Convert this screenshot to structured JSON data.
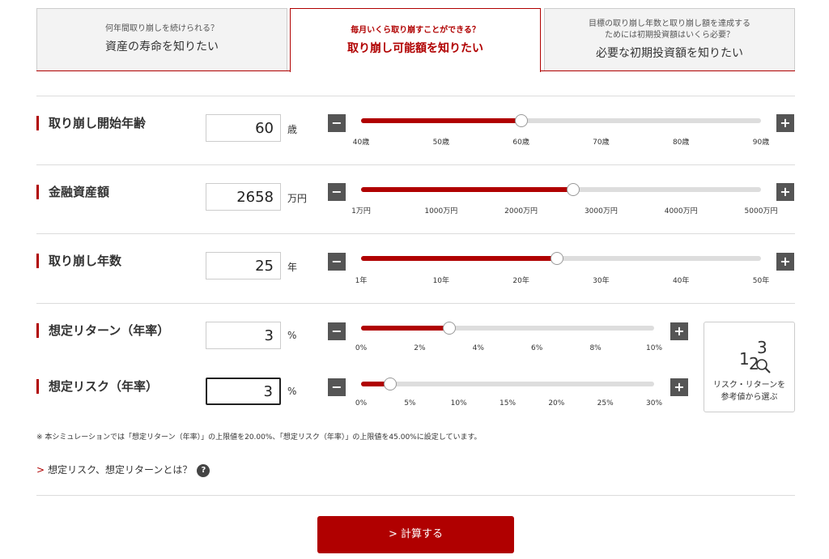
{
  "tabs": [
    {
      "sub": "何年間取り崩しを続けられる？",
      "sub2": "",
      "main": "資産の寿命を知りたい"
    },
    {
      "sub": "毎月いくら取り崩すことができる？",
      "sub2": "",
      "main": "取り崩し可能額を知りたい"
    },
    {
      "sub": "目標の取り崩し年数と取り崩し額を達成する",
      "sub2": "ためには初期投資額はいくら必要？",
      "main": "必要な初期投資額を知りたい"
    }
  ],
  "rows": {
    "age": {
      "label": "取り崩し開始年齢",
      "value": "60",
      "unit": "歳",
      "fill": 0.4,
      "ticks": [
        "40歳",
        "50歳",
        "60歳",
        "70歳",
        "80歳",
        "90歳"
      ]
    },
    "assets": {
      "label": "金融資産額",
      "value": "2658",
      "unit": "万円",
      "fill": 0.53,
      "ticks": [
        "1万円",
        "1000万円",
        "2000万円",
        "3000万円",
        "4000万円",
        "5000万円"
      ]
    },
    "years": {
      "label": "取り崩し年数",
      "value": "25",
      "unit": "年",
      "fill": 0.49,
      "ticks": [
        "1年",
        "10年",
        "20年",
        "30年",
        "40年",
        "50年"
      ]
    },
    "return": {
      "label": "想定リターン（年率）",
      "value": "3",
      "unit": "%",
      "fill": 0.3,
      "ticks": [
        "0%",
        "2%",
        "4%",
        "6%",
        "8%",
        "10%"
      ]
    },
    "risk": {
      "label": "想定リスク（年率）",
      "value": "3",
      "unit": "%",
      "fill": 0.1,
      "ticks": [
        "0%",
        "5%",
        "10%",
        "15%",
        "20%",
        "25%",
        "30%"
      ]
    }
  },
  "buttons": {
    "minus": "−",
    "plus": "+"
  },
  "risk_box": {
    "digits": "123",
    "line1": "リスク・リターンを",
    "line2": "参考値から選ぶ"
  },
  "note": "※ 本シミュレーションでは「想定リターン（年率）」の上限値を20.00%、「想定リスク（年率）」の上限値を45.00%に設定しています。",
  "link": {
    "arrow": ">",
    "text": "想定リスク、想定リターンとは？",
    "help": "?"
  },
  "calc": {
    "label": "> 計算する"
  },
  "colors": {
    "accent": "#b00000",
    "track": "#dddddd",
    "button": "#555555"
  }
}
